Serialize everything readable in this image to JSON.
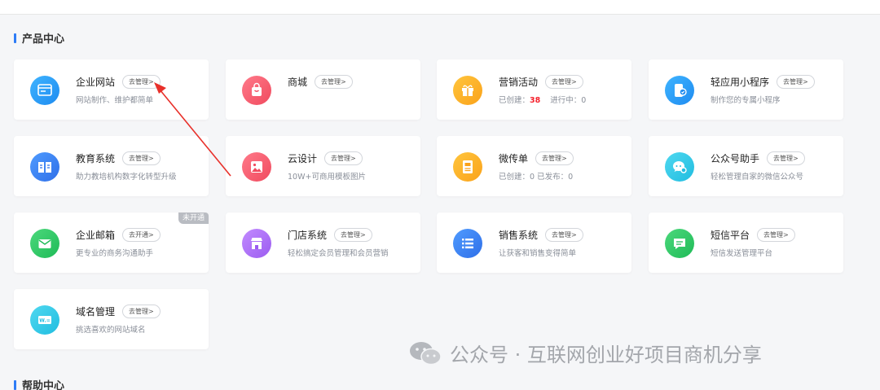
{
  "sections": {
    "product_center": "产品中心",
    "help_center": "帮助中心"
  },
  "cards": [
    {
      "title": "企业网站",
      "button": "去管理>",
      "desc": "网站制作、维护都简单"
    },
    {
      "title": "商城",
      "button": "去管理>",
      "desc": ""
    },
    {
      "title": "营销活动",
      "button": "去管理>",
      "desc_prefix": "已创建：",
      "desc_value": "38",
      "desc_suffix": "进行中：0"
    },
    {
      "title": "轻应用小程序",
      "button": "去管理>",
      "desc": "制作您的专属小程序"
    },
    {
      "title": "教育系统",
      "button": "去管理>",
      "desc": "助力教培机构数字化转型升级"
    },
    {
      "title": "云设计",
      "button": "去管理>",
      "desc": "10W+可商用模板图片"
    },
    {
      "title": "微传单",
      "button": "去管理>",
      "desc": "已创建：0    已发布：0"
    },
    {
      "title": "公众号助手",
      "button": "去管理>",
      "desc": "轻松管理自家的微信公众号"
    },
    {
      "title": "企业邮箱",
      "button": "去开通>",
      "desc": "更专业的商务沟通助手",
      "badge": "未开通"
    },
    {
      "title": "门店系统",
      "button": "去管理>",
      "desc": "轻松搞定会员管理和会员营销"
    },
    {
      "title": "销售系统",
      "button": "去管理>",
      "desc": "让获客和销售变得简单"
    },
    {
      "title": "短信平台",
      "button": "去管理>",
      "desc": "短信发送管理平台"
    },
    {
      "title": "域名管理",
      "button": "去管理>",
      "desc": "挑选喜欢的网站域名"
    }
  ],
  "icons": [
    "website-icon",
    "shop-bag-icon",
    "gift-icon",
    "mini-program-icon",
    "book-icon",
    "image-icon",
    "flyer-icon",
    "chat-bubble-gear-icon",
    "mail-icon",
    "store-icon",
    "list-icon",
    "message-icon",
    "domain-www-icon"
  ],
  "colors": {
    "accent": "#2e7cf6",
    "highlight_red": "#f5222d",
    "arrow_red": "#e8302a"
  },
  "watermark": "公众号 · 互联网创业好项目商机分享"
}
